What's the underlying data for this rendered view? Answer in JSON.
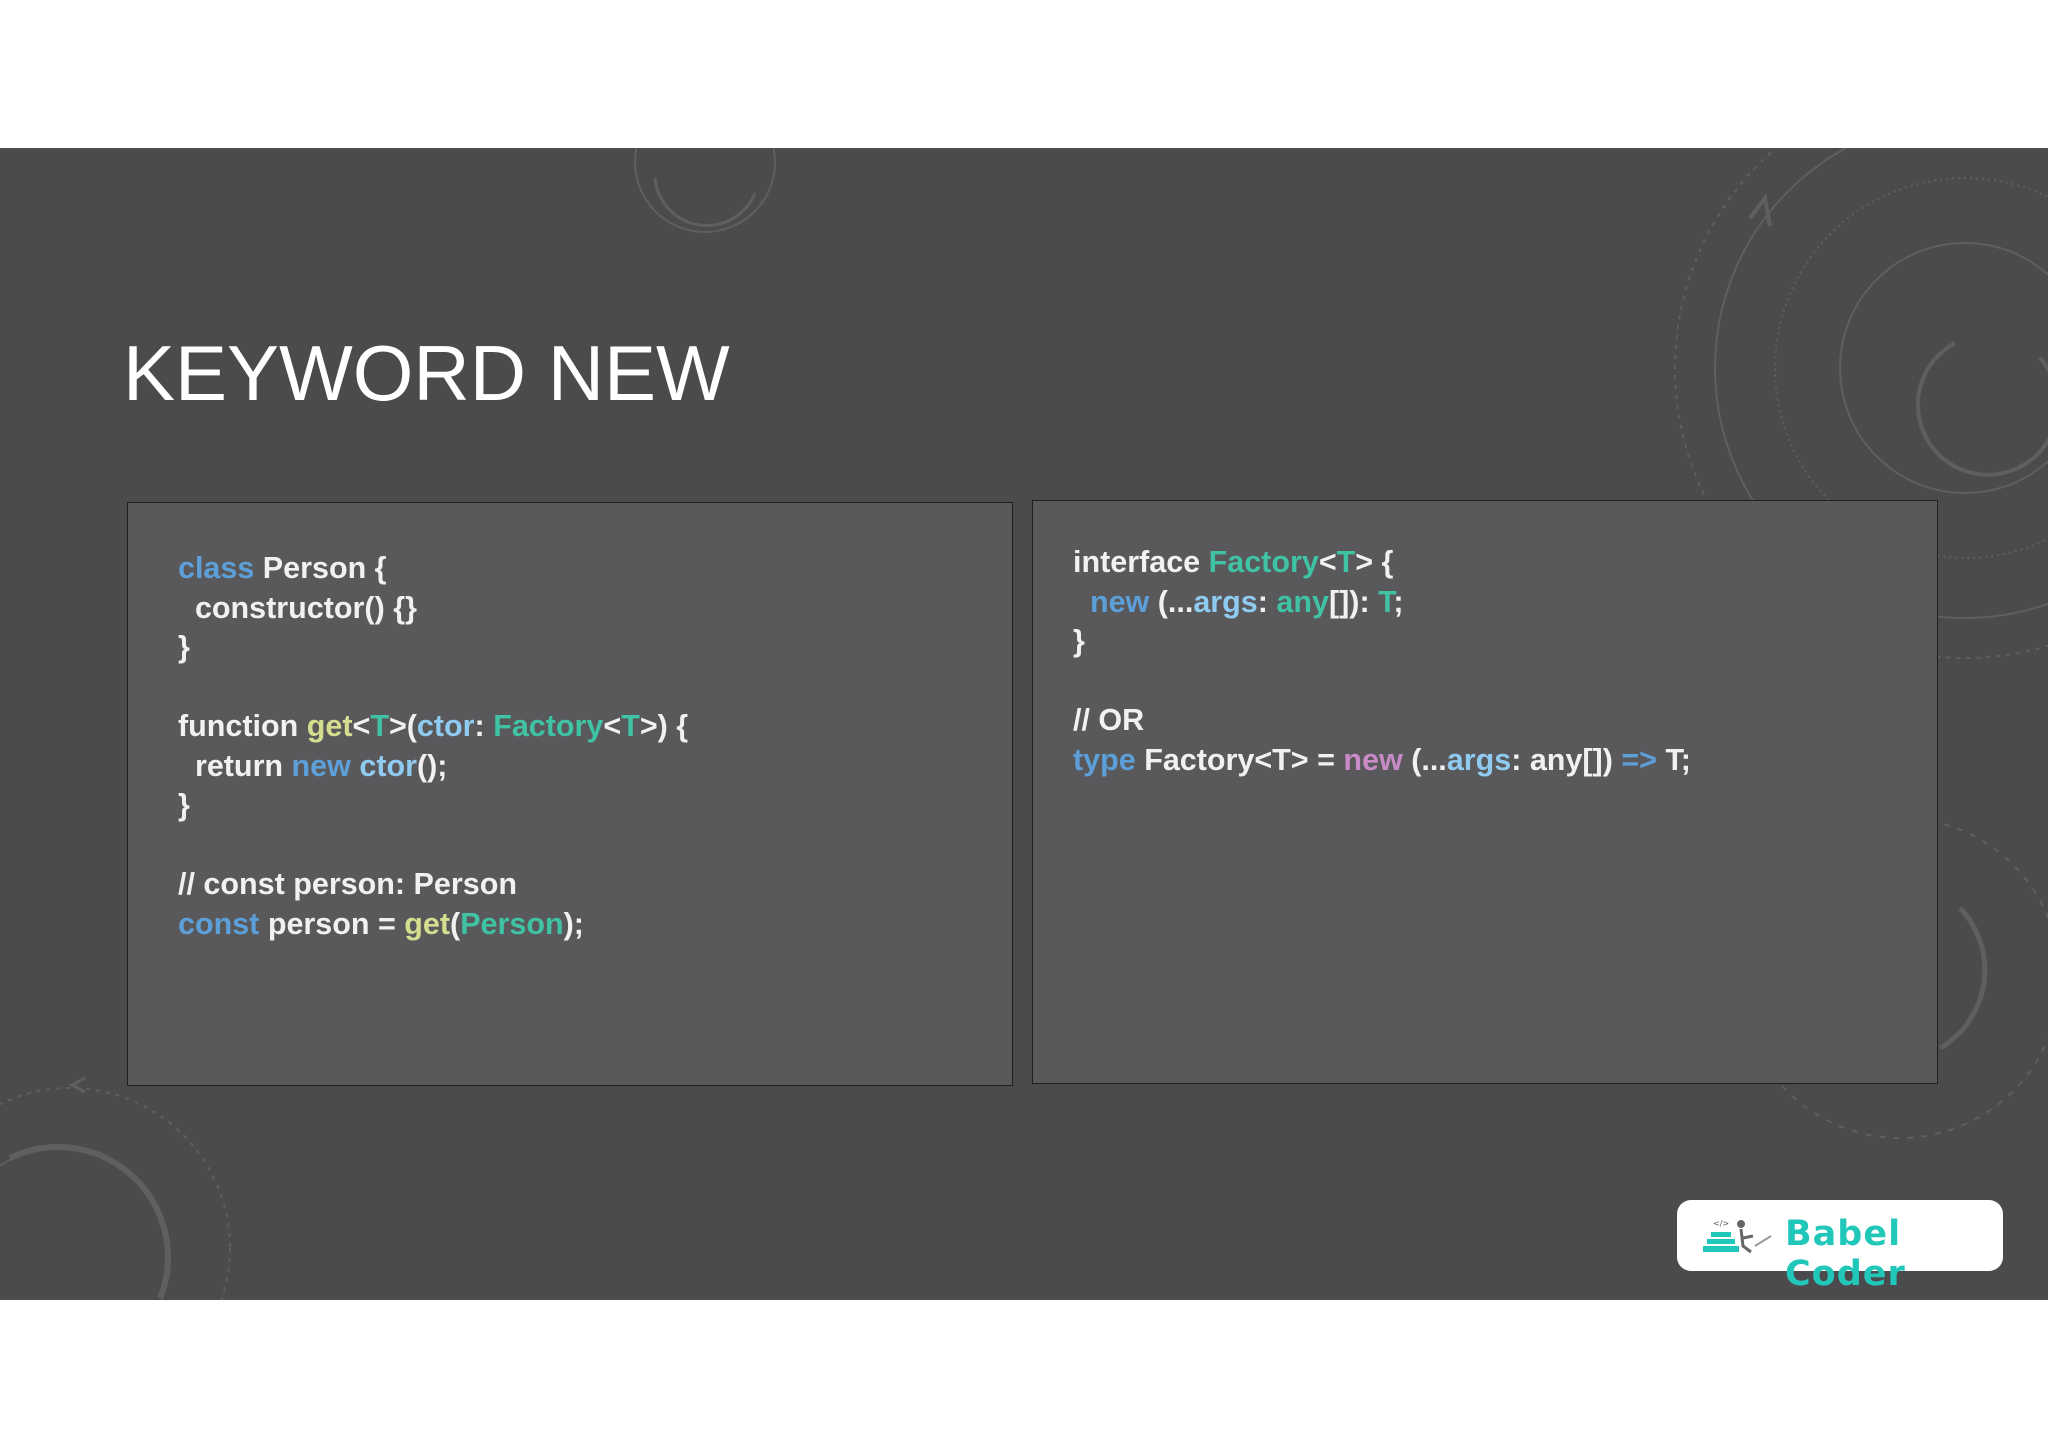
{
  "slide": {
    "title": "KEYWORD NEW"
  },
  "colors": {
    "plain": "#f1f1f1",
    "keyword": "#5d9fd8",
    "type": "#3fc3a4",
    "func": "#d5dd8e",
    "param": "#8fcbf1",
    "new_pink": "#c98ac8",
    "brand": "#21c8ba"
  },
  "left_code": {
    "lines": [
      [
        {
          "t": "class",
          "c": "keyword"
        },
        {
          "t": " Person {",
          "c": "plain"
        }
      ],
      [
        {
          "t": "  constructor() {}",
          "c": "plain"
        }
      ],
      [
        {
          "t": "}",
          "c": "plain"
        }
      ],
      [],
      [
        {
          "t": "function ",
          "c": "plain"
        },
        {
          "t": "get",
          "c": "func"
        },
        {
          "t": "<",
          "c": "plain"
        },
        {
          "t": "T",
          "c": "type"
        },
        {
          "t": ">(",
          "c": "plain"
        },
        {
          "t": "ctor",
          "c": "param"
        },
        {
          "t": ": ",
          "c": "plain"
        },
        {
          "t": "Factory",
          "c": "type"
        },
        {
          "t": "<",
          "c": "plain"
        },
        {
          "t": "T",
          "c": "type"
        },
        {
          "t": ">) {",
          "c": "plain"
        }
      ],
      [
        {
          "t": "  return ",
          "c": "plain"
        },
        {
          "t": "new",
          "c": "keyword"
        },
        {
          "t": " ",
          "c": "plain"
        },
        {
          "t": "ctor",
          "c": "param"
        },
        {
          "t": "();",
          "c": "plain"
        }
      ],
      [
        {
          "t": "}",
          "c": "plain"
        }
      ],
      [],
      [
        {
          "t": "// const person: Person",
          "c": "plain"
        }
      ],
      [
        {
          "t": "const",
          "c": "keyword"
        },
        {
          "t": " person = ",
          "c": "plain"
        },
        {
          "t": "get",
          "c": "func"
        },
        {
          "t": "(",
          "c": "plain"
        },
        {
          "t": "Person",
          "c": "type"
        },
        {
          "t": ");",
          "c": "plain"
        }
      ]
    ]
  },
  "right_code": {
    "lines": [
      [
        {
          "t": "interface ",
          "c": "plain"
        },
        {
          "t": "Factory",
          "c": "type"
        },
        {
          "t": "<",
          "c": "plain"
        },
        {
          "t": "T",
          "c": "type"
        },
        {
          "t": "> {",
          "c": "plain"
        }
      ],
      [
        {
          "t": "  ",
          "c": "plain"
        },
        {
          "t": "new",
          "c": "keyword"
        },
        {
          "t": " (...",
          "c": "plain"
        },
        {
          "t": "args",
          "c": "param"
        },
        {
          "t": ": ",
          "c": "plain"
        },
        {
          "t": "any",
          "c": "type"
        },
        {
          "t": "[]): ",
          "c": "plain"
        },
        {
          "t": "T",
          "c": "type"
        },
        {
          "t": ";",
          "c": "plain"
        }
      ],
      [
        {
          "t": "}",
          "c": "plain"
        }
      ],
      [],
      [
        {
          "t": "// OR",
          "c": "plain"
        }
      ],
      [
        {
          "t": "type",
          "c": "keyword"
        },
        {
          "t": " Factory<T> = ",
          "c": "plain"
        },
        {
          "t": "new",
          "c": "new_pink"
        },
        {
          "t": " (...",
          "c": "plain"
        },
        {
          "t": "args",
          "c": "param"
        },
        {
          "t": ": any[]) ",
          "c": "plain"
        },
        {
          "t": "=>",
          "c": "keyword"
        },
        {
          "t": " T;",
          "c": "plain"
        }
      ]
    ]
  },
  "logo": {
    "text": "Babel Coder",
    "icon": "babel-coder-logo-icon"
  }
}
